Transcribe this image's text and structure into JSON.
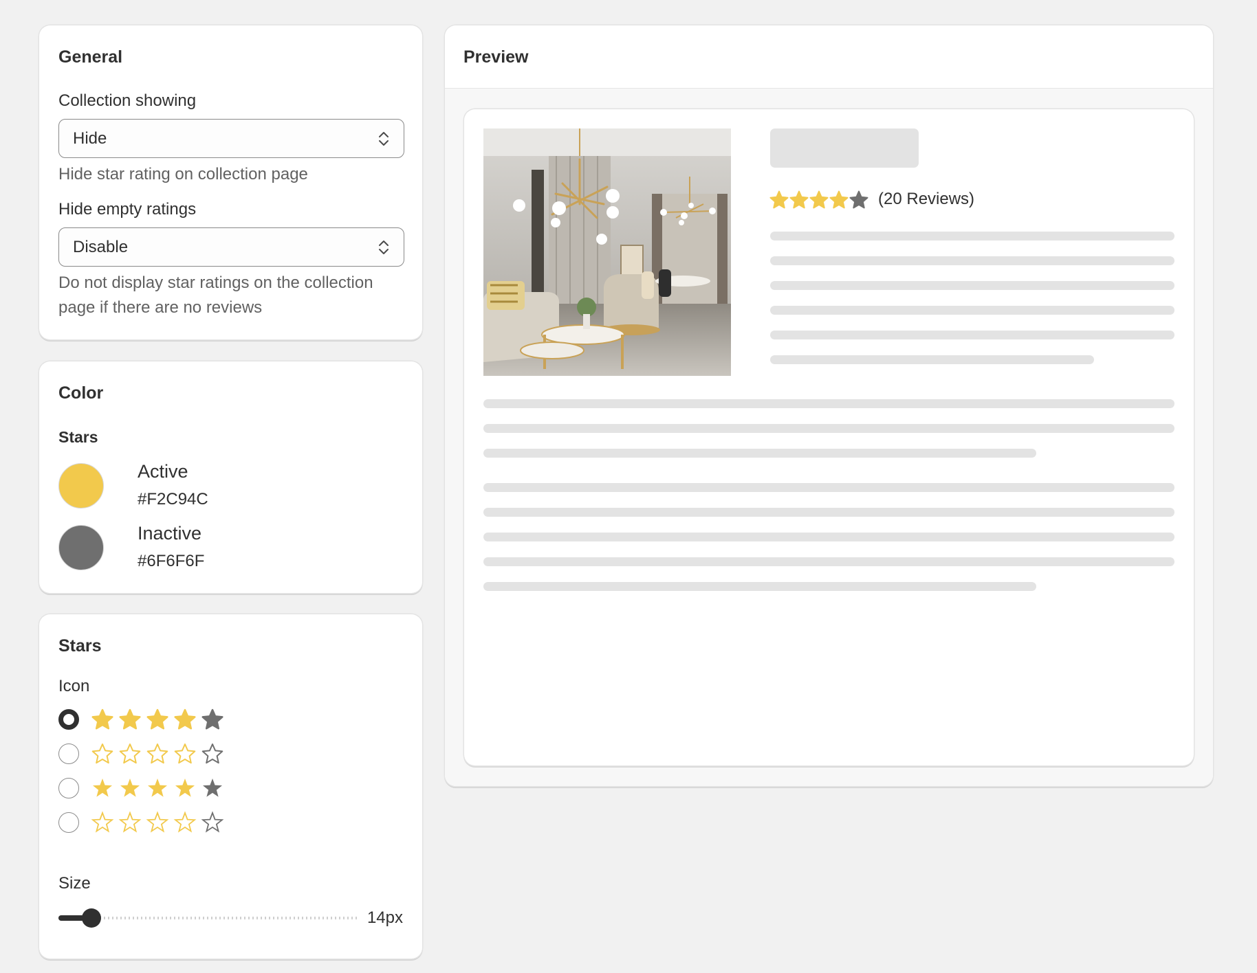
{
  "general": {
    "title": "General",
    "collection_showing": {
      "label": "Collection showing",
      "value": "Hide",
      "help": "Hide star rating on collection page"
    },
    "hide_empty": {
      "label": "Hide empty ratings",
      "value": "Disable",
      "help": "Do not display star ratings on the collection page if there are no reviews"
    }
  },
  "color": {
    "title": "Color",
    "section_label": "Stars",
    "active": {
      "name": "Active",
      "hex": "#F2C94C"
    },
    "inactive": {
      "name": "Inactive",
      "hex": "#6F6F6F"
    }
  },
  "stars": {
    "title": "Stars",
    "icon_label": "Icon",
    "icon_options": [
      {
        "shape": "rounded-star",
        "style": "filled",
        "checked": true
      },
      {
        "shape": "rounded-star",
        "style": "outline",
        "checked": false
      },
      {
        "shape": "sharp-star",
        "style": "filled",
        "checked": false
      },
      {
        "shape": "sharp-star",
        "style": "outline",
        "checked": false
      }
    ],
    "rating": 4,
    "max_rating": 5,
    "size_label": "Size",
    "size_value": "14px",
    "size_fraction": 0.11
  },
  "preview": {
    "title": "Preview",
    "reviews_text": "(20 Reviews)",
    "rating": 4,
    "image_icon": "living-room-photo"
  }
}
